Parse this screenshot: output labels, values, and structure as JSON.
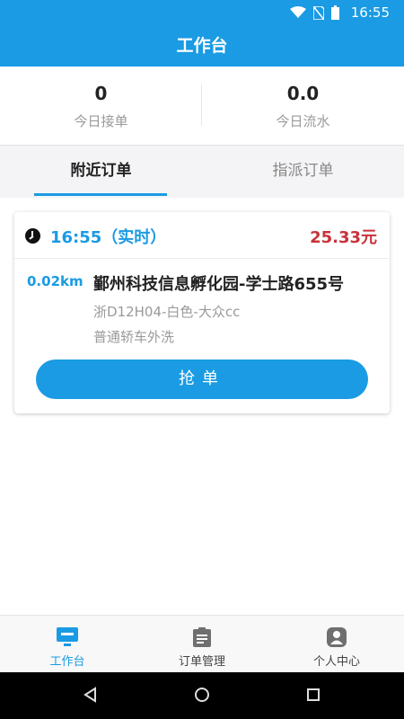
{
  "status_bar": {
    "time": "16:55",
    "icons": [
      "wifi-icon",
      "no-sim-icon",
      "battery-icon"
    ]
  },
  "appbar": {
    "title": "工作台"
  },
  "stats": [
    {
      "value": "0",
      "label": "今日接单"
    },
    {
      "value": "0.0",
      "label": "今日流水"
    }
  ],
  "tabs": [
    {
      "label": "附近订单",
      "active": true
    },
    {
      "label": "指派订单",
      "active": false
    }
  ],
  "order": {
    "time_label": "16:55（实时）",
    "price": "25.33元",
    "distance": "0.02km",
    "address": "鄞州科技信息孵化园-学士路655号",
    "car": "浙D12H04-白色-大众cc",
    "service": "普通轿车外洗",
    "button": "抢单"
  },
  "bottom_nav": [
    {
      "label": "工作台",
      "icon": "monitor-icon",
      "active": true
    },
    {
      "label": "订单管理",
      "icon": "clipboard-icon",
      "active": false
    },
    {
      "label": "个人中心",
      "icon": "user-icon",
      "active": false
    }
  ],
  "colors": {
    "primary": "#1a9be3",
    "price": "#c8323a",
    "muted": "#9a9a9a"
  },
  "system_nav": [
    "back-icon",
    "home-icon",
    "recents-icon"
  ]
}
